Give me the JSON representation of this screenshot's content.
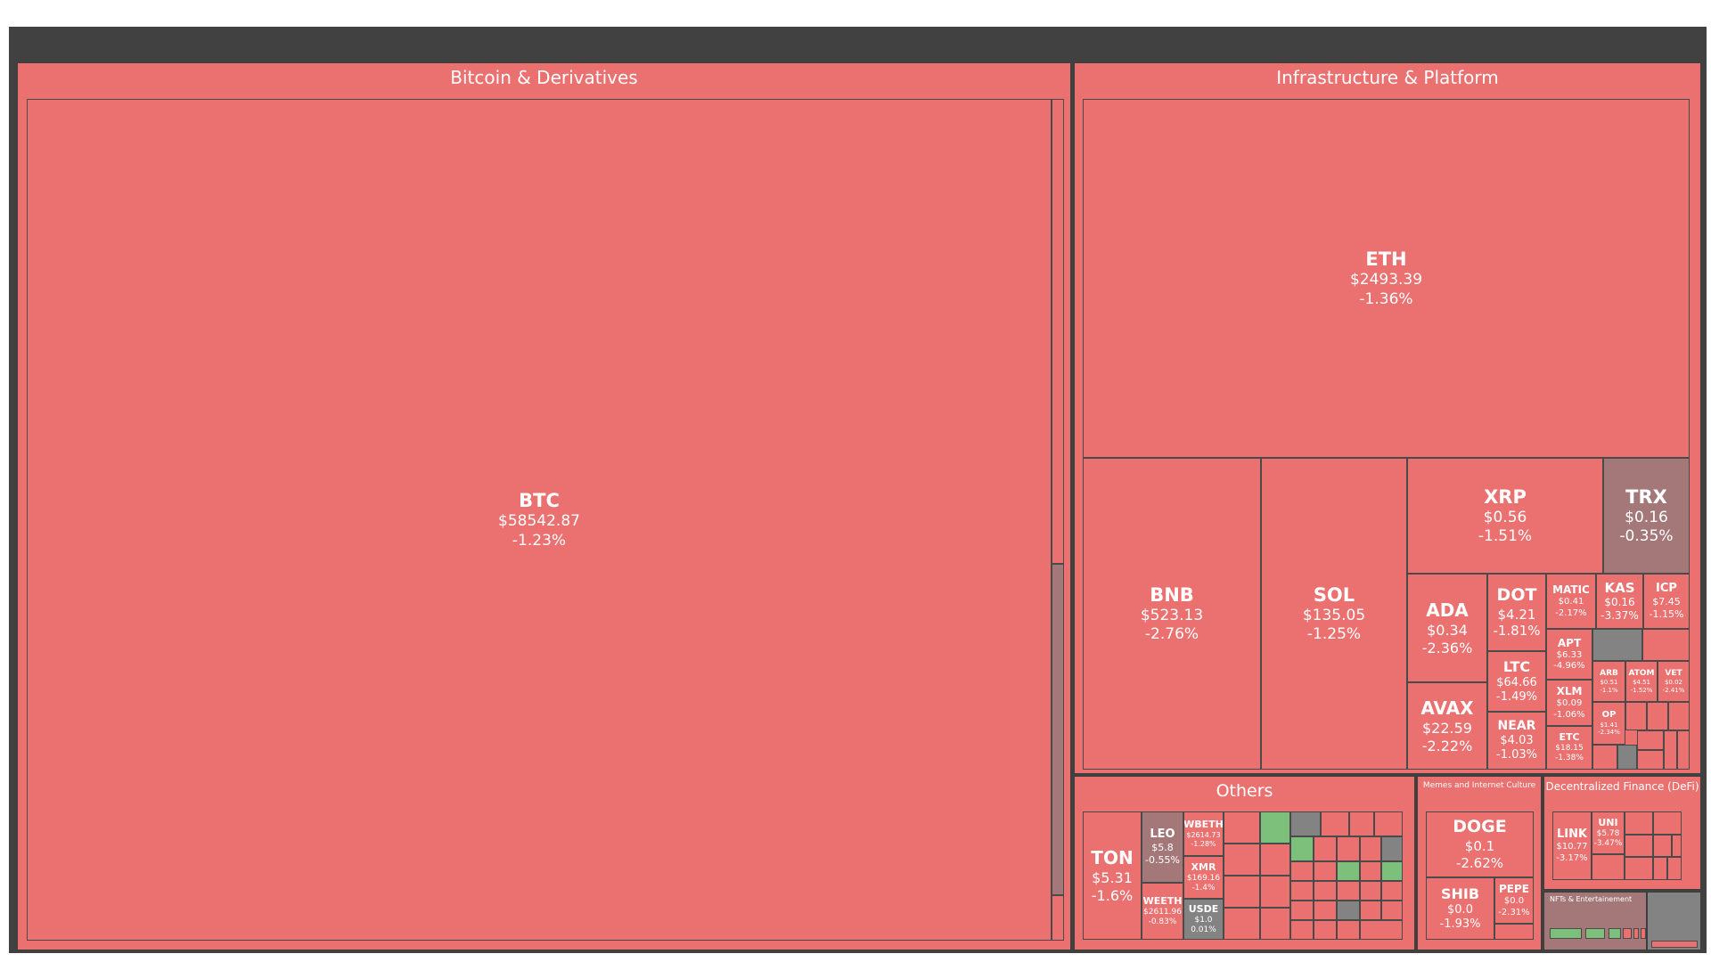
{
  "chart_data": {
    "type": "treemap",
    "colors": {
      "background": "#414141",
      "negative": "#eb7070",
      "slightly_negative": "#a47878",
      "neutral": "#838383",
      "positive": "#7cc07c"
    },
    "groups": [
      {
        "name": "Bitcoin & Derivatives",
        "tiles": [
          {
            "symbol": "BTC",
            "price": "$58542.87",
            "change": "-1.23%"
          }
        ]
      },
      {
        "name": "Infrastructure & Platform",
        "tiles": [
          {
            "symbol": "ETH",
            "price": "$2493.39",
            "change": "-1.36%"
          },
          {
            "symbol": "BNB",
            "price": "$523.13",
            "change": "-2.76%"
          },
          {
            "symbol": "SOL",
            "price": "$135.05",
            "change": "-1.25%"
          },
          {
            "symbol": "XRP",
            "price": "$0.56",
            "change": "-1.51%"
          },
          {
            "symbol": "TRX",
            "price": "$0.16",
            "change": "-0.35%"
          },
          {
            "symbol": "ADA",
            "price": "$0.34",
            "change": "-2.36%"
          },
          {
            "symbol": "AVAX",
            "price": "$22.59",
            "change": "-2.22%"
          },
          {
            "symbol": "DOT",
            "price": "$4.21",
            "change": "-1.81%"
          },
          {
            "symbol": "LTC",
            "price": "$64.66",
            "change": "-1.49%"
          },
          {
            "symbol": "NEAR",
            "price": "$4.03",
            "change": "-1.03%"
          },
          {
            "symbol": "MATIC",
            "price": "$0.41",
            "change": "-2.17%"
          },
          {
            "symbol": "KAS",
            "price": "$0.16",
            "change": "-3.37%"
          },
          {
            "symbol": "ICP",
            "price": "$7.45",
            "change": "-1.15%"
          },
          {
            "symbol": "APT",
            "price": "$6.33",
            "change": "-4.96%"
          },
          {
            "symbol": "XLM",
            "price": "$0.09",
            "change": "-1.06%"
          },
          {
            "symbol": "ETC",
            "price": "$18.15",
            "change": "-1.38%"
          },
          {
            "symbol": "ARB",
            "price": "$0.51",
            "change": "-1.1%"
          },
          {
            "symbol": "ATOM",
            "price": "$4.51",
            "change": "-1.52%"
          },
          {
            "symbol": "VET",
            "price": "$0.02",
            "change": "-2.41%"
          },
          {
            "symbol": "OP",
            "price": "$1.41",
            "change": "-2.34%"
          }
        ]
      },
      {
        "name": "Others",
        "tiles": [
          {
            "symbol": "TON",
            "price": "$5.31",
            "change": "-1.6%"
          },
          {
            "symbol": "LEO",
            "price": "$5.8",
            "change": "-0.55%"
          },
          {
            "symbol": "WEETH",
            "price": "$2611.96",
            "change": "-0.83%"
          },
          {
            "symbol": "WBETH",
            "price": "$2614.73",
            "change": "-1.28%"
          },
          {
            "symbol": "XMR",
            "price": "$169.16",
            "change": "-1.4%"
          },
          {
            "symbol": "USDE",
            "price": "$1.0",
            "change": "0.01%"
          }
        ]
      },
      {
        "name": "Memes and Internet Culture",
        "tiles": [
          {
            "symbol": "DOGE",
            "price": "$0.1",
            "change": "-2.62%"
          },
          {
            "symbol": "SHIB",
            "price": "$0.0",
            "change": "-1.93%"
          },
          {
            "symbol": "PEPE",
            "price": "$0.0",
            "change": "-2.31%"
          }
        ]
      },
      {
        "name": "Decentralized Finance (DeFi)",
        "tiles": [
          {
            "symbol": "LINK",
            "price": "$10.77",
            "change": "-3.17%"
          },
          {
            "symbol": "UNI",
            "price": "$5.78",
            "change": "-3.47%"
          }
        ]
      },
      {
        "name": "NFTs & Entertainement",
        "tiles": []
      }
    ]
  }
}
